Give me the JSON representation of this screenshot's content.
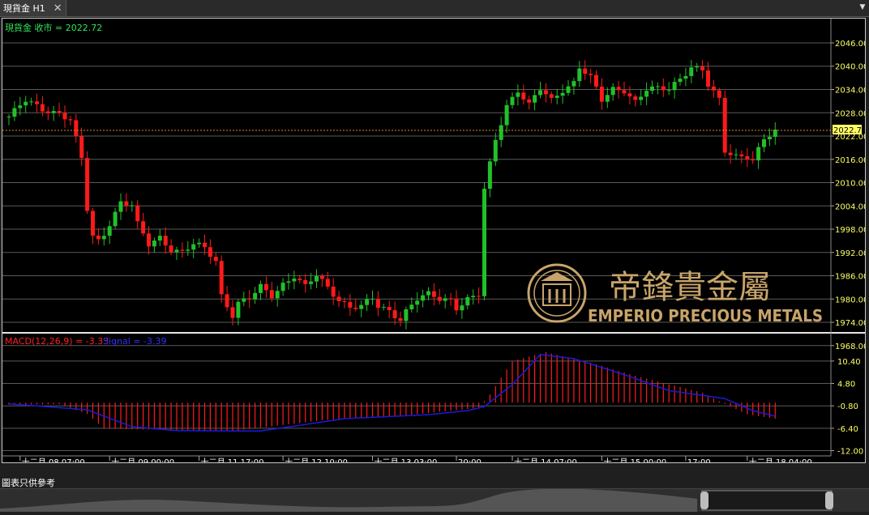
{
  "tab": {
    "title": "現貨金 H1",
    "close_glyph": "✕",
    "menu_glyph": "▼"
  },
  "price_panel": {
    "symbol_label": "現貨金 收市 = 2022.72",
    "last_price_label": "2022.72"
  },
  "macd_panel": {
    "label": "MACD(12,26,9) = -3.33",
    "signal_label": "Signal = -3.39"
  },
  "watermark": {
    "name_zh": "帝鋒貴金屬",
    "name_en": "EMPERIO PRECIOUS METALS"
  },
  "note": "圖表只供參考",
  "colors": {
    "up": "#22c02a",
    "down": "#ff1a1a",
    "signal": "#1a1adc",
    "price_text": "#ffff66",
    "grid": "#5a5a5a",
    "logo_gold": "#c9a46a"
  },
  "chart_data": [
    {
      "type": "candlestick",
      "title": "現貨金 H1",
      "last_close": 2022.72,
      "y_ticks": [
        "2046.00",
        "2040.00",
        "2034.00",
        "2028.00",
        "2022.00",
        "2016.00",
        "2010.00",
        "2004.00",
        "1998.00",
        "1992.00",
        "1986.00",
        "1980.00",
        "1974.00",
        "1968.00"
      ],
      "ylim": [
        1966.5,
        2048.5
      ],
      "x_ticks": [
        "十二月 08 07:00",
        "十二月 09 00:00",
        "十二月 11 17:00",
        "十二月 12 10:00",
        "十二月 13 03:00",
        "20:00",
        "十二月 14 07:00",
        "十二月 15 00:00",
        "17:00",
        "十二月 18 04:00"
      ],
      "close_path": [
        [
          0,
          2027
        ],
        [
          3,
          2031
        ],
        [
          6,
          2029
        ],
        [
          9,
          2028
        ],
        [
          11,
          2026
        ],
        [
          13,
          2016
        ],
        [
          14,
          2003
        ],
        [
          15,
          1996
        ],
        [
          16,
          1995
        ],
        [
          17,
          1997
        ],
        [
          20,
          2005
        ],
        [
          22,
          2004
        ],
        [
          23,
          1999
        ],
        [
          25,
          1994
        ],
        [
          27,
          1996
        ],
        [
          29,
          1993
        ],
        [
          31,
          1992
        ],
        [
          33,
          1994
        ],
        [
          35,
          1993
        ],
        [
          37,
          1990
        ],
        [
          38,
          1981
        ],
        [
          40,
          1976
        ],
        [
          41,
          1979
        ],
        [
          43,
          1980
        ],
        [
          45,
          1983
        ],
        [
          47,
          1981
        ],
        [
          49,
          1984
        ],
        [
          51,
          1986
        ],
        [
          53,
          1983
        ],
        [
          55,
          1986
        ],
        [
          57,
          1983
        ],
        [
          59,
          1980
        ],
        [
          61,
          1978
        ],
        [
          63,
          1978
        ],
        [
          65,
          1980
        ],
        [
          66,
          1978
        ],
        [
          68,
          1977
        ],
        [
          70,
          1975
        ],
        [
          71,
          1977
        ],
        [
          73,
          1980
        ],
        [
          75,
          1981
        ],
        [
          77,
          1980
        ],
        [
          79,
          1980
        ],
        [
          80,
          1978
        ],
        [
          82,
          1980
        ],
        [
          84,
          1981
        ],
        [
          85,
          2008
        ],
        [
          87,
          2021
        ],
        [
          89,
          2030
        ],
        [
          91,
          2034
        ],
        [
          93,
          2030
        ],
        [
          95,
          2034
        ],
        [
          97,
          2031
        ],
        [
          99,
          2034
        ],
        [
          101,
          2036
        ],
        [
          102,
          2040
        ],
        [
          104,
          2037
        ],
        [
          106,
          2031
        ],
        [
          108,
          2034
        ],
        [
          110,
          2034
        ],
        [
          112,
          2031
        ],
        [
          114,
          2034
        ],
        [
          116,
          2034
        ],
        [
          118,
          2034
        ],
        [
          120,
          2037
        ],
        [
          122,
          2040
        ],
        [
          124,
          2039
        ],
        [
          125,
          2035
        ],
        [
          127,
          2031
        ],
        [
          128,
          2018
        ],
        [
          130,
          2017
        ],
        [
          132,
          2017
        ],
        [
          133,
          2016
        ],
        [
          135,
          2021
        ],
        [
          137,
          2023
        ]
      ]
    },
    {
      "type": "bar+line",
      "title": "MACD(12,26,9)",
      "y_ticks": [
        "10.40",
        "4.80",
        "-0.80",
        "-6.40",
        "-12.00"
      ],
      "ylim": [
        -12.9,
        13.4
      ],
      "histogram_keypoints": [
        [
          0,
          -0.5
        ],
        [
          9,
          -0.4
        ],
        [
          14,
          -2.8
        ],
        [
          17,
          -6.5
        ],
        [
          40,
          -7.1
        ],
        [
          56,
          -4.4
        ],
        [
          70,
          -3.3
        ],
        [
          84,
          -1.3
        ],
        [
          86,
          2.0
        ],
        [
          90,
          10.4
        ],
        [
          96,
          12.6
        ],
        [
          104,
          10.0
        ],
        [
          112,
          6.7
        ],
        [
          124,
          2.5
        ],
        [
          126,
          1.0
        ],
        [
          132,
          -2.9
        ],
        [
          137,
          -4.0
        ]
      ],
      "signal_keypoints": [
        [
          0,
          -0.3
        ],
        [
          14,
          -1.8
        ],
        [
          22,
          -6.0
        ],
        [
          30,
          -7.0
        ],
        [
          45,
          -7.1
        ],
        [
          60,
          -4.0
        ],
        [
          75,
          -3.0
        ],
        [
          82,
          -2.0
        ],
        [
          85,
          -1.0
        ],
        [
          90,
          4.5
        ],
        [
          95,
          12.0
        ],
        [
          101,
          11.0
        ],
        [
          110,
          7.0
        ],
        [
          118,
          3.0
        ],
        [
          128,
          1.0
        ],
        [
          133,
          -2.0
        ],
        [
          137,
          -3.4
        ]
      ],
      "last_macd": -3.33,
      "last_signal": -3.39
    }
  ]
}
